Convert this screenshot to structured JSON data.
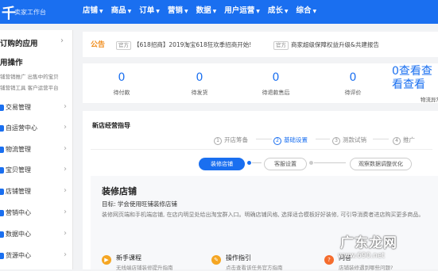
{
  "app": {
    "logo_glyph": "千",
    "subtitle": "卖家工作台"
  },
  "nav": [
    {
      "label": "店铺",
      "arrow": "▼"
    },
    {
      "label": "商品",
      "arrow": "▼"
    },
    {
      "label": "订单",
      "arrow": "▼"
    },
    {
      "label": "营销",
      "arrow": "▼"
    },
    {
      "label": "数据",
      "arrow": "▼"
    },
    {
      "label": "用户运营",
      "arrow": "▼"
    },
    {
      "label": "成长",
      "arrow": "▼"
    },
    {
      "label": "综合",
      "arrow": "▼"
    }
  ],
  "sidebar": {
    "header": "订购的应用",
    "header_arrow": "›",
    "group_title": "用操作",
    "quick_links_row1": "铺营销推广  出售中的宝贝",
    "quick_links_row2": "铺营销工具  客户运营平台",
    "items": [
      {
        "label": "交易管理",
        "chevron": "›"
      },
      {
        "label": "自运营中心",
        "chevron": "›"
      },
      {
        "label": "物流管理",
        "chevron": "›"
      },
      {
        "label": "宝贝管理",
        "chevron": "›"
      },
      {
        "label": "店铺管理",
        "chevron": "›"
      },
      {
        "label": "营销中心",
        "chevron": "›"
      },
      {
        "label": "数据中心",
        "chevron": "›"
      },
      {
        "label": "货源中心",
        "chevron": "›"
      }
    ]
  },
  "notice": {
    "title": "公告",
    "badge1": "官方",
    "text1": "【618招商】2019淘宝618狂欢季招商开始!",
    "badge2": "官方",
    "text2": "商家超级保障权益升级&共建报告"
  },
  "stats": [
    {
      "value": "0",
      "label": "待付款"
    },
    {
      "value": "0",
      "label": "待发货"
    },
    {
      "value": "0",
      "label": "待退款售后"
    },
    {
      "value": "0",
      "label": "待评价"
    }
  ],
  "stats_tail": {
    "value": "0查看查看查看",
    "label": "物流异常"
  },
  "guide": {
    "title": "新店经营指导",
    "steps": [
      {
        "num": "1",
        "label": "开店筹备"
      },
      {
        "num": "2",
        "label": "基础设置"
      },
      {
        "num": "3",
        "label": "测款试销"
      },
      {
        "num": "4",
        "label": "推广"
      }
    ],
    "substeps": [
      "装修店铺",
      "客服设置",
      "观察数据调整优化"
    ],
    "panel": {
      "title": "装修店铺",
      "goal": "目标: 学会使用旺铺装修店铺",
      "desc": "装修网页端和手机端店铺, 在店内明显处给出淘宝群入口。明确店铺风格, 选择适合模板好好装修, 可引导消费者进店购买更多商品。"
    },
    "cards": [
      {
        "title": "新手课程",
        "sub": "无线端店铺装修提升指南",
        "color": "#f5a623",
        "icon": "▶"
      },
      {
        "title": "操作指引",
        "sub": "点击查看该任务官方指南",
        "color": "#f5a623",
        "icon": "✎"
      },
      {
        "title": "问答",
        "sub": "店铺装修遇到哪些问题?",
        "color": "#f56c2d",
        "icon": "?"
      }
    ]
  },
  "watermark": {
    "text": "广东龙网",
    "url": "www.690.net"
  }
}
